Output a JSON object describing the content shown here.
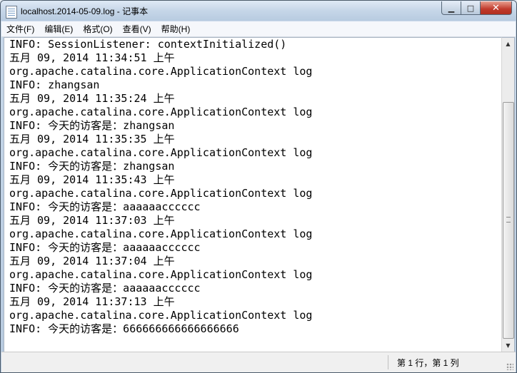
{
  "window": {
    "title": "localhost.2014-05-09.log - 记事本",
    "minimize": "▁",
    "maximize": "□",
    "close": "✕"
  },
  "menu": [
    {
      "label": "文件(F)"
    },
    {
      "label": "编辑(E)"
    },
    {
      "label": "格式(O)"
    },
    {
      "label": "查看(V)"
    },
    {
      "label": "帮助(H)"
    }
  ],
  "document": {
    "lines": [
      "INFO: SessionListener: contextInitialized()",
      "五月 09, 2014 11:34:51 上午",
      "org.apache.catalina.core.ApplicationContext log",
      "INFO: zhangsan",
      "五月 09, 2014 11:35:24 上午",
      "org.apache.catalina.core.ApplicationContext log",
      "INFO: 今天的访客是：zhangsan",
      "五月 09, 2014 11:35:35 上午",
      "org.apache.catalina.core.ApplicationContext log",
      "INFO: 今天的访客是：zhangsan",
      "五月 09, 2014 11:35:43 上午",
      "org.apache.catalina.core.ApplicationContext log",
      "INFO: 今天的访客是：aaaaaacccccc",
      "五月 09, 2014 11:37:03 上午",
      "org.apache.catalina.core.ApplicationContext log",
      "INFO: 今天的访客是：aaaaaacccccc",
      "五月 09, 2014 11:37:04 上午",
      "org.apache.catalina.core.ApplicationContext log",
      "INFO: 今天的访客是：aaaaaacccccc",
      "五月 09, 2014 11:37:13 上午",
      "org.apache.catalina.core.ApplicationContext log",
      "INFO: 今天的访客是：666666666666666666"
    ]
  },
  "scrollbar": {
    "up_arrow": "▲",
    "down_arrow": "▼"
  },
  "status": {
    "position": "第 1 行，第 1 列"
  }
}
